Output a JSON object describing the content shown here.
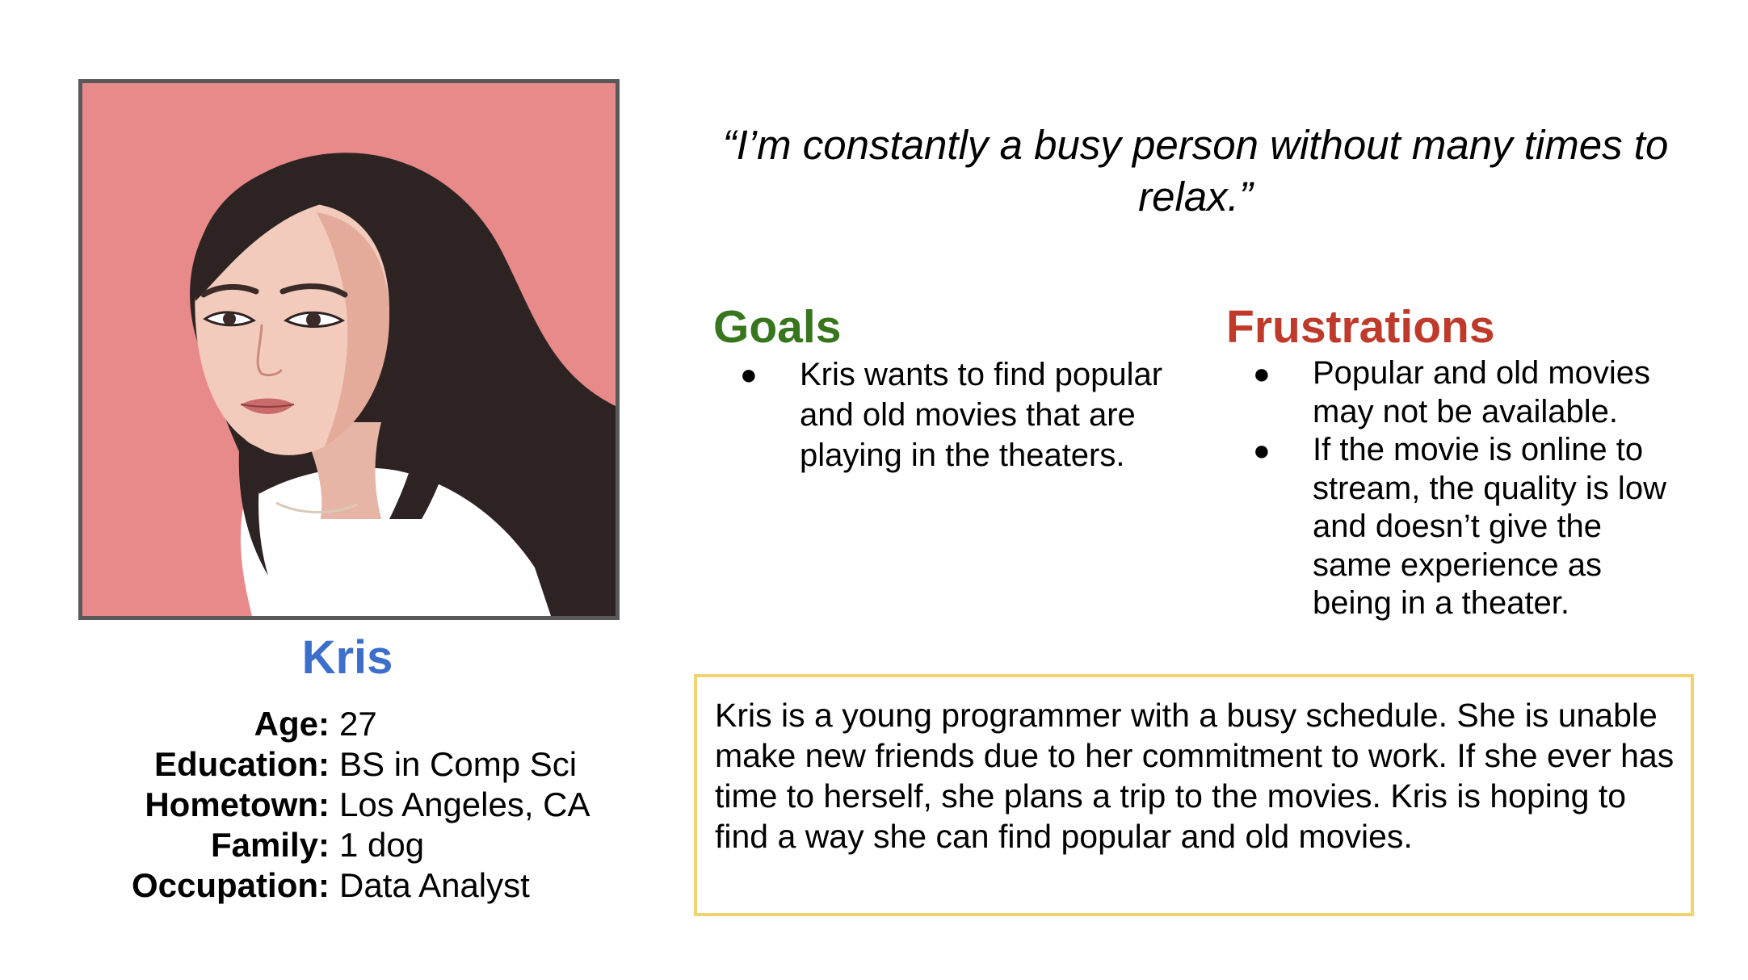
{
  "persona": {
    "name": "Kris",
    "details": [
      {
        "label": "Age:",
        "value": "27"
      },
      {
        "label": "Education:",
        "value": "BS in Comp Sci"
      },
      {
        "label": "Hometown:",
        "value": "Los Angeles, CA"
      },
      {
        "label": "Family:",
        "value": "1 dog"
      },
      {
        "label": "Occupation:",
        "value": "Data Analyst"
      }
    ]
  },
  "quote": "“I’m constantly a busy person without many times to relax.”",
  "goals": {
    "title": "Goals",
    "items": [
      "Kris wants to find popular and old movies that are playing in the theaters."
    ]
  },
  "frustrations": {
    "title": "Frustrations",
    "items": [
      "Popular and old movies may not be available.",
      "If the movie is online to stream, the quality is low and doesn’t give the same experience as being in a theater."
    ]
  },
  "bio": "Kris is a young programmer with a busy schedule. She is unable make new friends due to her commitment to work. If she ever has time to herself, she plans a trip to the movies. Kris is hoping to find a way she can find popular and old movies.",
  "bullet_glyph": "●",
  "colors": {
    "name": "#3c6fcb",
    "goals": "#38761d",
    "frustrations": "#bf3a2b",
    "bio_border": "#f2d373",
    "portrait_bg": "#e8898a",
    "frame": "#595959"
  },
  "icons": {
    "portrait": "woman-portrait-illustration"
  }
}
